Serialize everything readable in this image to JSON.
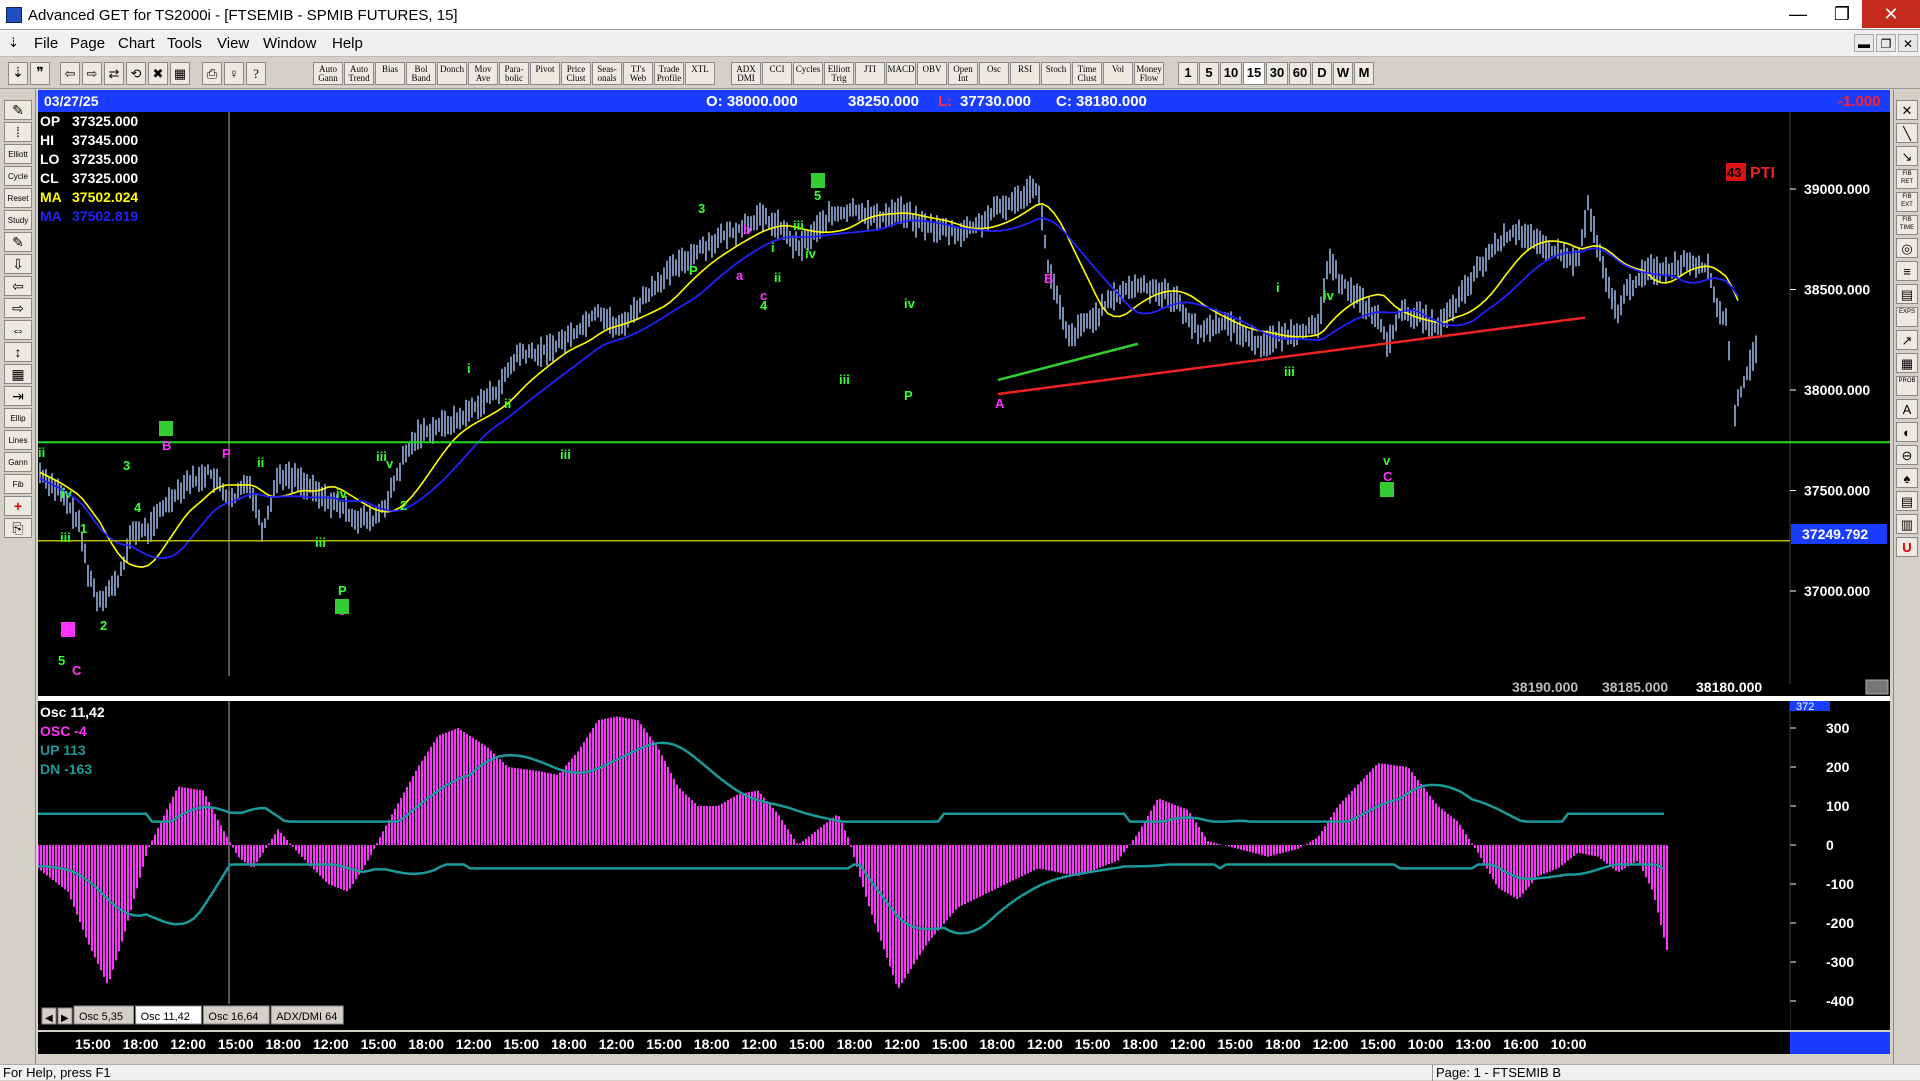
{
  "window": {
    "title": "Advanced GET for TS2000i - [FTSEMIB - SPMIB FUTURES, 15]",
    "minimize": "—",
    "maximize": "❐",
    "close": "✕"
  },
  "menu": [
    "File",
    "Page",
    "Chart",
    "Tools",
    "View",
    "Window",
    "Help"
  ],
  "toolbar": {
    "buttons": [
      "Auto Gann",
      "Auto Trend",
      "Bias",
      "Bol Band",
      "Donch",
      "Mov Ave",
      "Para-bolic",
      "Pivot",
      "Price Clust",
      "Seas-onals",
      "TJ's Web",
      "Trade Profile",
      "XTL",
      "ADX DMI",
      "CCI",
      "Cycles",
      "Elliott Trig",
      "JTI",
      "MACD",
      "OBV",
      "Open Int",
      "Osc",
      "RSI",
      "Stoch",
      "Time Clust",
      "Vol",
      "Money Flow"
    ],
    "periods": [
      "1",
      "5",
      "10",
      "15",
      "30",
      "60",
      "D",
      "W",
      "M"
    ],
    "active_period": "15"
  },
  "left_tools": [
    "Elliott",
    "Cycle",
    "Reset",
    "Study",
    "Ellip",
    "Lines",
    "Gann",
    "Fib"
  ],
  "right_tools": [
    "FIB RET",
    "FIB EXT",
    "FIB TIME",
    "PROB",
    "EXPS"
  ],
  "price_panel": {
    "date": "03/27/25",
    "header": {
      "open": "O: 38000.000",
      "high": "38250.000",
      "low_label": "L:",
      "low": "37730.000",
      "close": "C: 38180.000",
      "change": "-1.000"
    },
    "data_window": [
      {
        "label": "OP",
        "value": "37325.000",
        "color": "#ffffff"
      },
      {
        "label": "HI",
        "value": "37345.000",
        "color": "#ffffff"
      },
      {
        "label": "LO",
        "value": "37235.000",
        "color": "#ffffff"
      },
      {
        "label": "CL",
        "value": "37325.000",
        "color": "#ffffff"
      },
      {
        "label": "MA",
        "value": "37502.024",
        "color": "#ffff00"
      },
      {
        "label": "MA",
        "value": "37502.819",
        "color": "#2222ff"
      }
    ],
    "pti": {
      "value": "43",
      "label": "PTI"
    },
    "y_axis_labels": [
      "39000.000",
      "38500.000",
      "38000.000",
      "37500.000",
      "37000.000"
    ],
    "y_axis_values": [
      39000,
      38500,
      38000,
      37500,
      37000
    ],
    "highlight_level": "37249.792",
    "bottom_values": [
      "38190.000",
      "38185.000",
      "38180.000"
    ]
  },
  "osc_panel": {
    "legend": [
      {
        "text": "Osc 11,42",
        "color": "#ffffff"
      },
      {
        "text": "OSC -4",
        "color": "#ff33ff"
      },
      {
        "text": "UP   113",
        "color": "#1a9a9a"
      },
      {
        "text": "DN   -163",
        "color": "#1a9a9a"
      }
    ],
    "y_axis_labels": [
      "300",
      "200",
      "100",
      "0",
      "-100",
      "-200",
      "-300",
      "-400"
    ],
    "y_axis_values": [
      300,
      200,
      100,
      0,
      -100,
      -200,
      -300,
      -400
    ],
    "top_cut_label": "372",
    "tabs": [
      "Osc 5,35",
      "Osc 11,42",
      "Osc 16,64",
      "ADX/DMI 64"
    ],
    "active_tab": "Osc 11,42"
  },
  "time_axis": [
    "15:00",
    "18:00",
    "12:00",
    "15:00",
    "18:00",
    "12:00",
    "15:00",
    "18:00",
    "12:00",
    "15:00",
    "18:00",
    "12:00",
    "15:00",
    "18:00",
    "12:00",
    "15:00",
    "18:00",
    "12:00",
    "15:00",
    "18:00",
    "12:00",
    "15:00",
    "18:00",
    "12:00",
    "15:00",
    "18:00",
    "12:00",
    "15:00",
    "10:00",
    "13:00",
    "16:00",
    "10:00"
  ],
  "wave_labels": [
    {
      "text": "ii",
      "color": "#33ff33"
    },
    {
      "text": "iv",
      "color": "#33ff33"
    },
    {
      "text": "iii",
      "color": "#33ff33"
    },
    {
      "text": "1",
      "color": "#33ff33"
    },
    {
      "text": "5",
      "color": "#33ff33"
    },
    {
      "text": "2",
      "color": "#33ff33"
    },
    {
      "text": "C",
      "color": "#ff33ff"
    },
    {
      "text": "3",
      "color": "#33ff33"
    },
    {
      "text": "4",
      "color": "#33ff33"
    },
    {
      "text": "B",
      "color": "#ff33ff"
    },
    {
      "text": "ii",
      "color": "#33ff33"
    },
    {
      "text": "P",
      "color": "#ff33ff"
    },
    {
      "text": "iii",
      "color": "#33ff33"
    },
    {
      "text": "iv",
      "color": "#33ff33"
    },
    {
      "text": "P",
      "color": "#33ff33"
    },
    {
      "text": "C",
      "color": "#ff33ff"
    },
    {
      "text": "iii",
      "color": "#33ff33"
    },
    {
      "text": "v",
      "color": "#33ff33"
    },
    {
      "text": "2",
      "color": "#33ff33"
    },
    {
      "text": "i",
      "color": "#33ff33"
    },
    {
      "text": "ii",
      "color": "#33ff33"
    },
    {
      "text": "iii",
      "color": "#33ff33"
    },
    {
      "text": "3",
      "color": "#33ff33"
    },
    {
      "text": "P",
      "color": "#33ff33"
    },
    {
      "text": "b",
      "color": "#ff33ff"
    },
    {
      "text": "a",
      "color": "#ff33ff"
    },
    {
      "text": "c",
      "color": "#ff33ff"
    },
    {
      "text": "4",
      "color": "#33ff33"
    },
    {
      "text": "i",
      "color": "#33ff33"
    },
    {
      "text": "ii",
      "color": "#33ff33"
    },
    {
      "text": "iii",
      "color": "#33ff33"
    },
    {
      "text": "5",
      "color": "#33ff33"
    },
    {
      "text": "iv",
      "color": "#33ff33"
    },
    {
      "text": "iii",
      "color": "#33ff33"
    },
    {
      "text": "iv",
      "color": "#33ff33"
    },
    {
      "text": "P",
      "color": "#33ff33"
    },
    {
      "text": "A",
      "color": "#ff33ff"
    },
    {
      "text": "B",
      "color": "#ff33ff"
    },
    {
      "text": "i",
      "color": "#33ff33"
    },
    {
      "text": "iii",
      "color": "#33ff33"
    },
    {
      "text": "iv",
      "color": "#33ff33"
    },
    {
      "text": "v",
      "color": "#33ff33"
    },
    {
      "text": "C",
      "color": "#ff33ff"
    },
    {
      "text": "4",
      "color": "#33ff33"
    }
  ],
  "colors": {
    "price_bars": "#aac8ff",
    "ma_fast": "#ffff00",
    "ma_slow": "#2222ff",
    "support_line": "#22dd22",
    "level_line": "#b8b800",
    "red_trend": "#ee2222",
    "green_trend": "#33cc33",
    "osc_hist": "#ff33ff",
    "osc_bands": "#1a9a9a",
    "time_axis_bg": "#1a3cff"
  },
  "status": {
    "help": "For Help, press F1",
    "page": "Page: 1 - FTSEMIB B"
  }
}
